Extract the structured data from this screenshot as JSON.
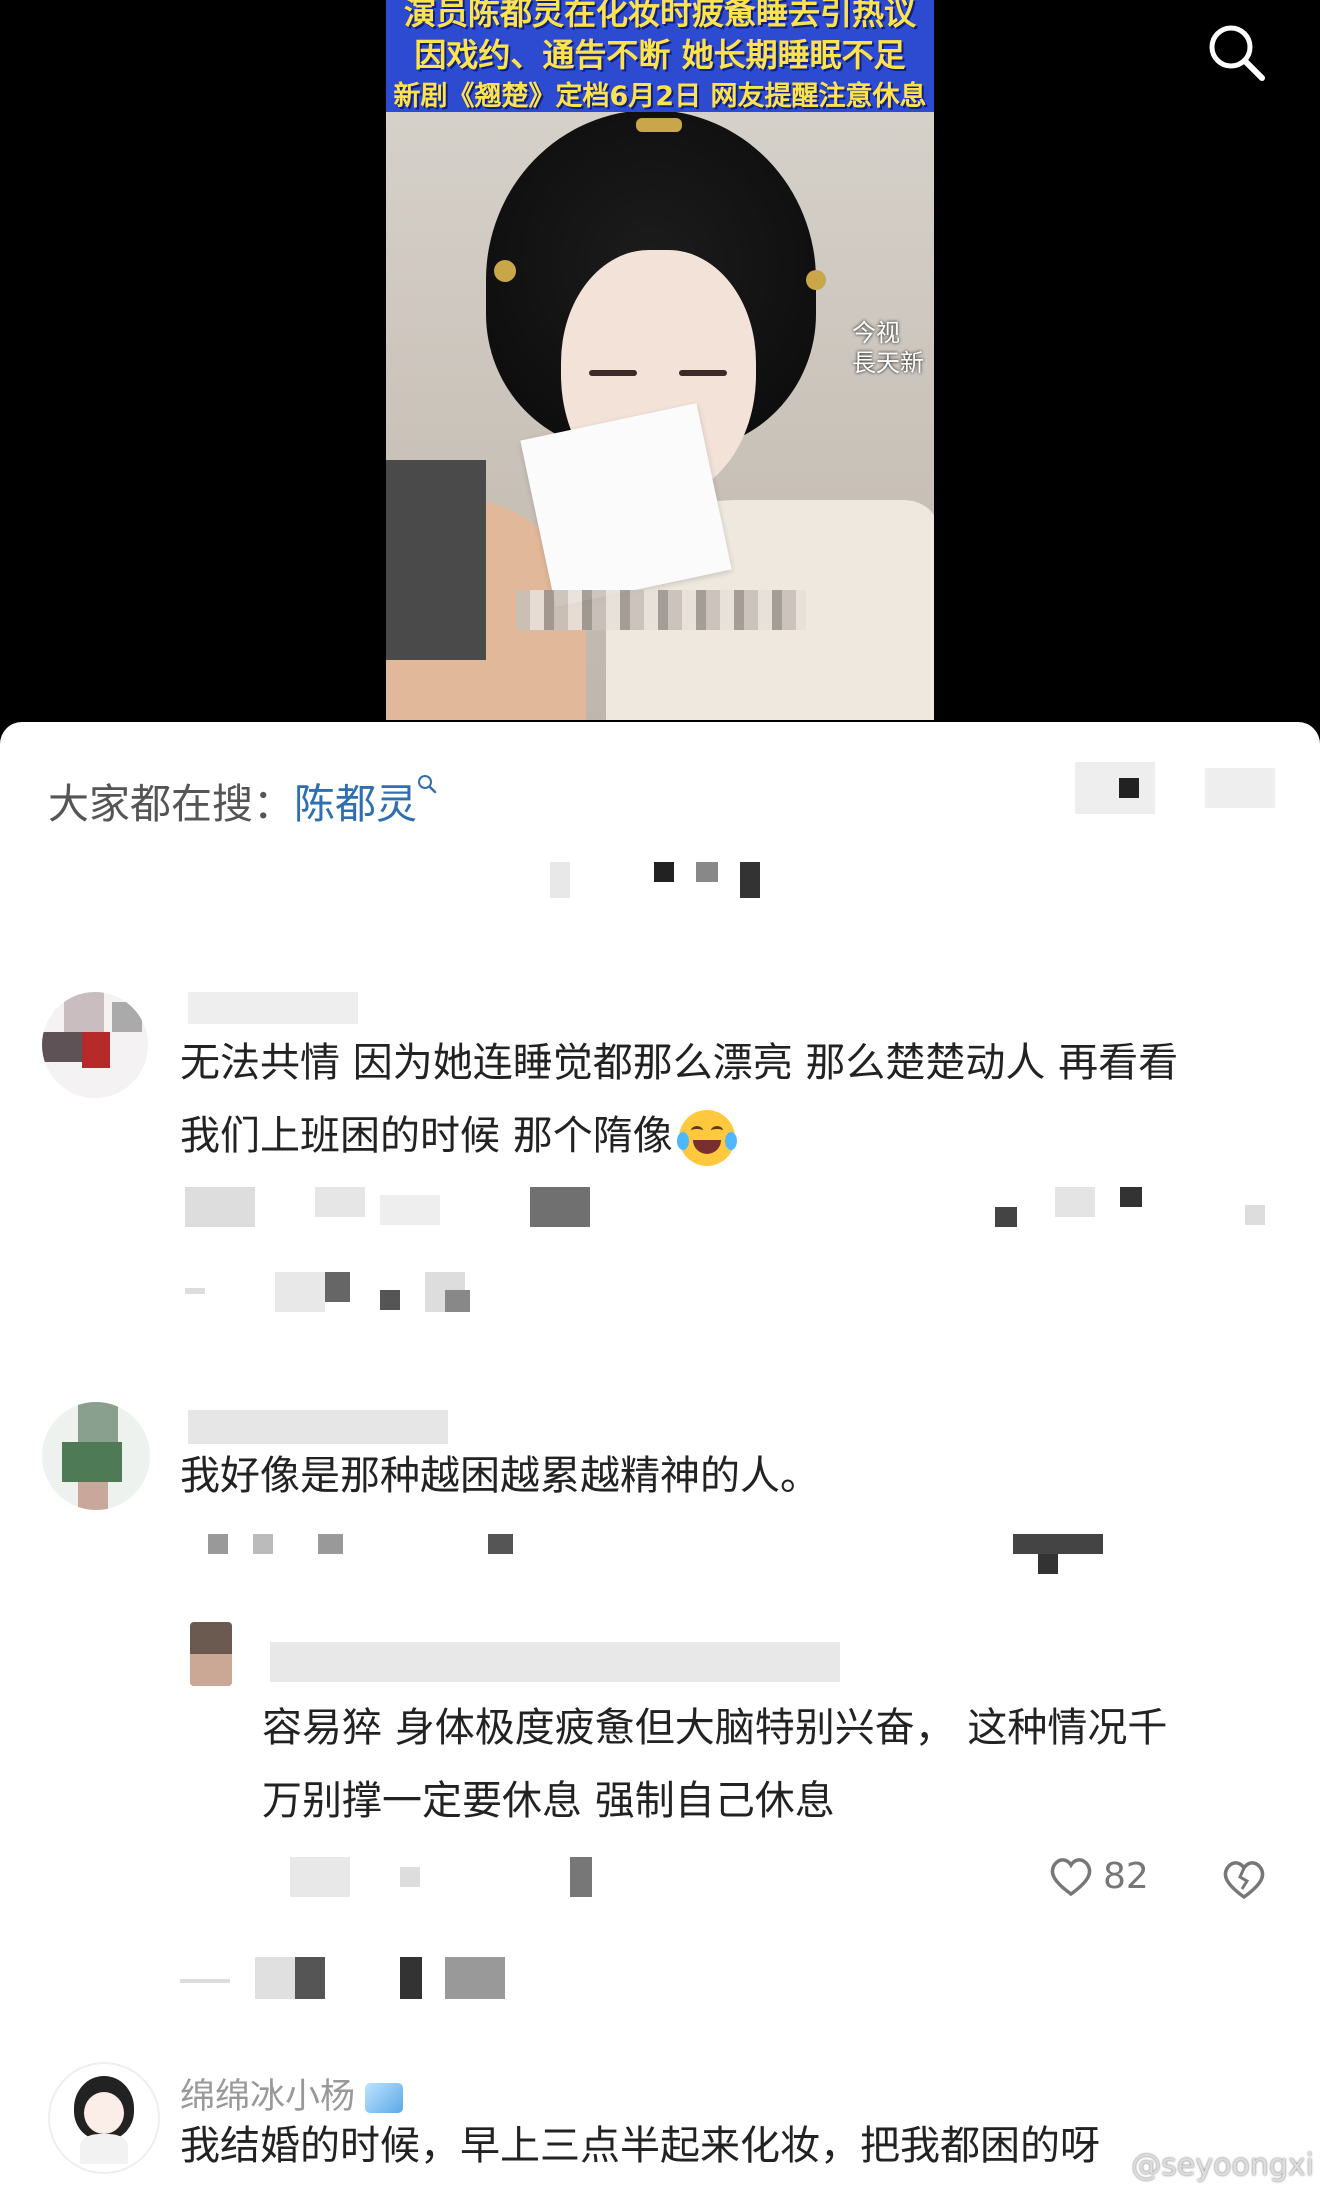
{
  "video": {
    "caption_lines": [
      "演员陈都灵在化妆时疲惫睡去引热议",
      "因戏约、通告不断 她长期睡眠不足",
      "新剧《翘楚》定档6月2日 网友提醒注意休息"
    ],
    "source_watermark_line1": "今视",
    "source_watermark_line2": "長天新"
  },
  "search_button_icon": "search-icon",
  "trending": {
    "prefix": "大家都在搜：",
    "keyword": "陈都灵"
  },
  "comments": [
    {
      "text_line1": "无法共情 因为她连睡觉都那么漂亮 那么楚楚动人 再看看",
      "text_line2": "我们上班困的时候 那个隋像"
    },
    {
      "text_line1": "我好像是那种越困越累越精神的人。"
    },
    {
      "reply_line1": "容易猝 身体极度疲惫但大脑特别兴奋， 这种情况千",
      "reply_line2": "万别撑一定要休息 强制自己休息",
      "like_count": "82"
    },
    {
      "username": "绵绵冰小杨",
      "text_line1": "我结婚的时候，早上三点半起来化妆，把我都困的呀"
    }
  ],
  "watermark": "@seyoongxi",
  "colors": {
    "caption_bg": "#2d4bd0",
    "caption_text": "#ffe34d",
    "keyword": "#2f6fb0"
  }
}
